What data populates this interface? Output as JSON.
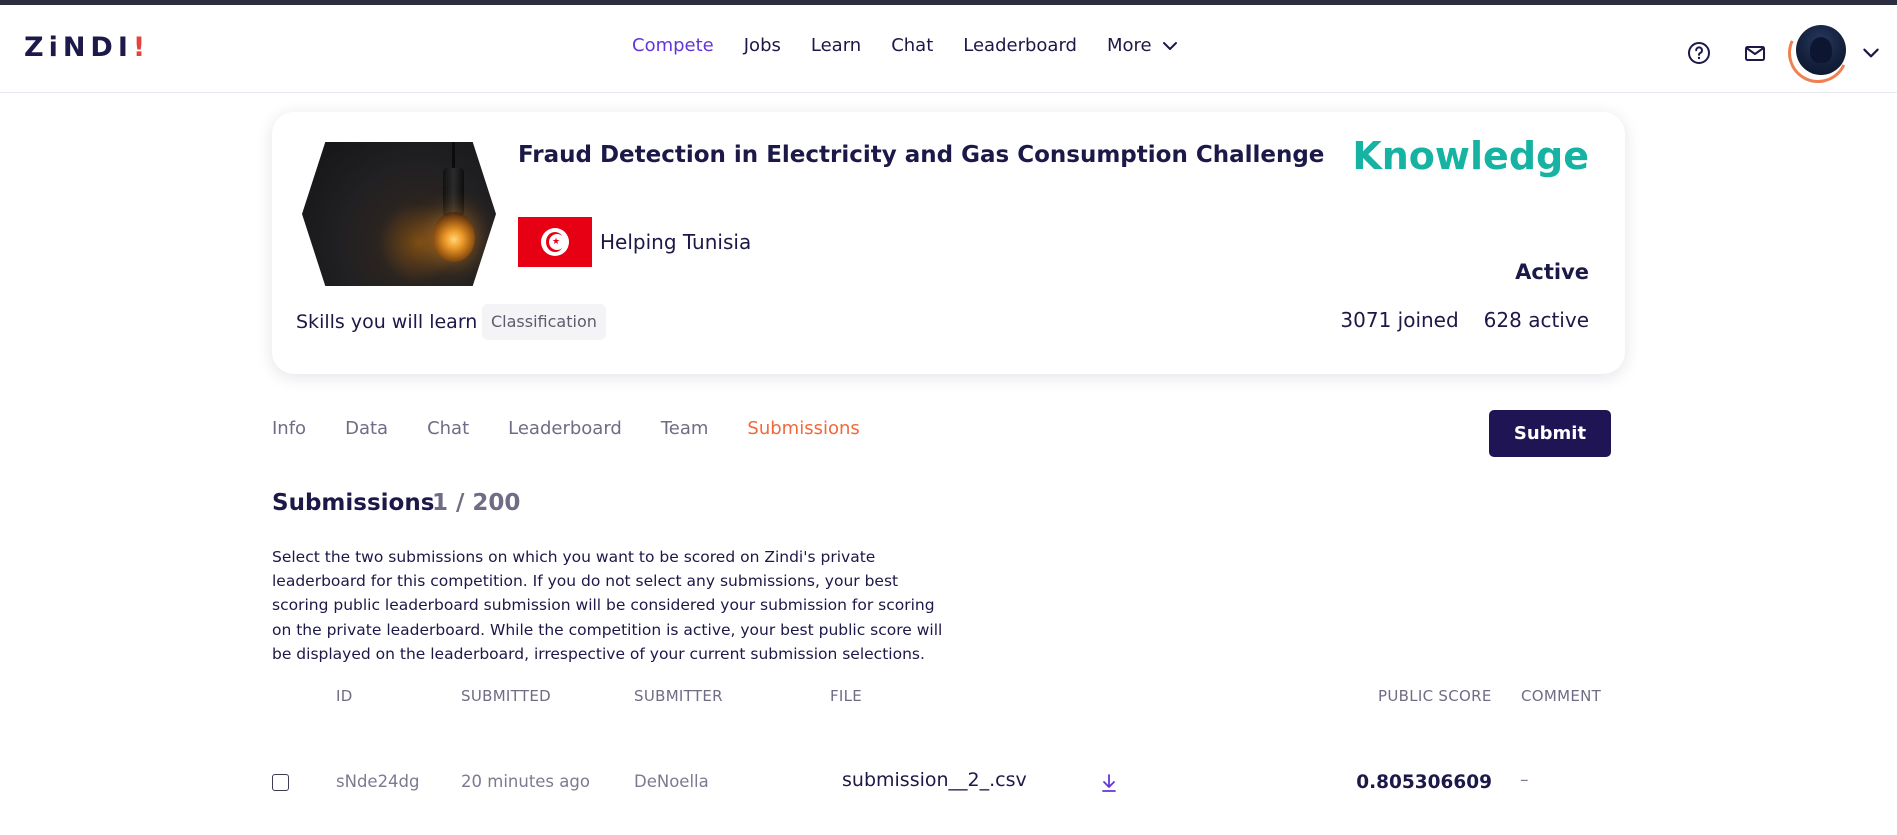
{
  "header": {
    "logo": "ZiNDI",
    "logo_bang": "!",
    "nav": [
      {
        "label": "Compete"
      },
      {
        "label": "Jobs"
      },
      {
        "label": "Learn"
      },
      {
        "label": "Chat"
      },
      {
        "label": "Leaderboard"
      },
      {
        "label": "More"
      }
    ],
    "icons": [
      "help-circle-icon",
      "mail-icon",
      "avatar",
      "chevron-down-icon"
    ]
  },
  "competition": {
    "title": "Fraud Detection in Electricity and Gas Consumption Challenge",
    "type": "Knowledge",
    "host": "Helping Tunisia",
    "skills_label": "Skills you will learn",
    "skills": [
      "Classification"
    ],
    "status": "Active",
    "joined": "3071 joined",
    "active": "628 active"
  },
  "tabs": [
    {
      "label": "Info"
    },
    {
      "label": "Data"
    },
    {
      "label": "Chat"
    },
    {
      "label": "Leaderboard"
    },
    {
      "label": "Team"
    },
    {
      "label": "Submissions"
    }
  ],
  "submit_label": "Submit",
  "submissions": {
    "title": "Submissions",
    "count": "1 / 200",
    "description": "Select the two submissions on which you want to be scored on Zindi's private leaderboard for this competition. If you do not select any submissions, your best scoring public leaderboard submission will be considered your submission for scoring on the private leaderboard. While the competition is active, your best public score will be displayed on the leaderboard, irrespective of your current submission selections.",
    "columns": [
      "ID",
      "SUBMITTED",
      "SUBMITTER",
      "FILE",
      "PUBLIC SCORE",
      "COMMENT"
    ],
    "rows": [
      {
        "id": "sNde24dg",
        "submitted": "20 minutes ago",
        "submitter": "DeNoella",
        "file": "submission__2_.csv",
        "public_score": "0.805306609",
        "comment": "–"
      }
    ]
  },
  "colors": {
    "accent_nav": "#6336d9",
    "accent_tab": "#f0683b",
    "knowledge": "#16b3a3",
    "submit_bg": "#1f1454",
    "text": "#1c1848"
  }
}
